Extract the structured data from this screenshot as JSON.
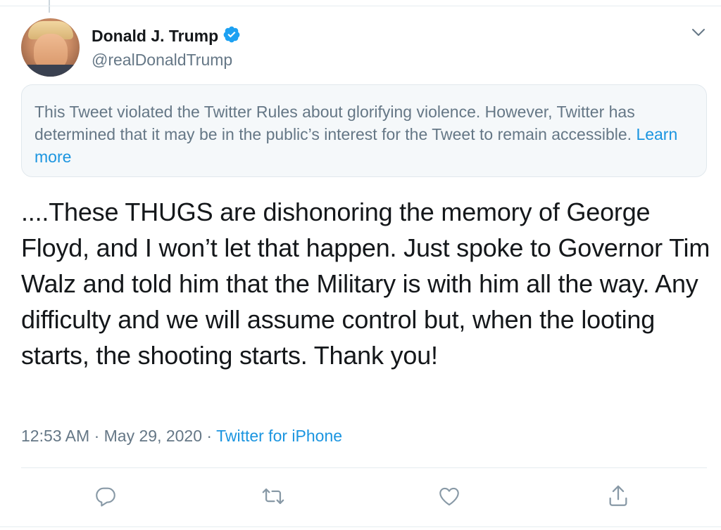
{
  "user": {
    "display_name": "Donald J. Trump",
    "handle": "@realDonaldTrump",
    "verified": true
  },
  "notice": {
    "text": "This Tweet violated the Twitter Rules about glorifying violence. However, Twitter has determined that it may be in the public’s interest for the Tweet to remain accessible.",
    "link_label": "Learn more"
  },
  "tweet": {
    "text": "....These THUGS are dishonoring the memory of George Floyd, and I won’t let that happen. Just spoke to Governor Tim Walz and told him that the Military is with him all the way. Any difficulty and we will assume control but, when the looting starts, the shooting starts. Thank you!"
  },
  "meta": {
    "time": "12:53 AM",
    "date": "May 29, 2020",
    "separator": "·",
    "source": "Twitter for iPhone"
  },
  "actions": [
    "reply-icon",
    "retweet-icon",
    "like-icon",
    "share-icon"
  ],
  "colors": {
    "link": "#1b95e0",
    "secondary_text": "#657786",
    "primary_text": "#14171a",
    "notice_bg": "#f5f8fa"
  }
}
